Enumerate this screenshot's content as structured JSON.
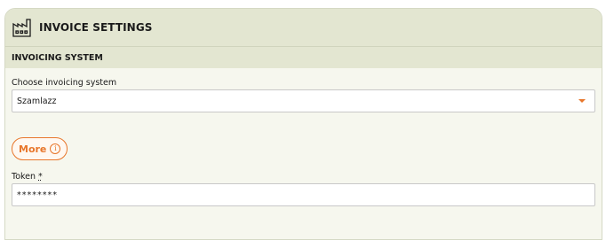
{
  "header": {
    "title": "INVOICE SETTINGS",
    "icon": "factory-icon"
  },
  "section": {
    "title": "INVOICING SYSTEM"
  },
  "system_field": {
    "label": "Choose invoicing system",
    "value": "Szamlazz"
  },
  "more_button": {
    "label": "More",
    "info_glyph": "i"
  },
  "token_field": {
    "label": "Token",
    "required_marker": "*",
    "value": "********"
  },
  "colors": {
    "accent": "#e8762b",
    "header_bg": "#e3e6d1",
    "panel_bg": "#f6f7ee"
  }
}
